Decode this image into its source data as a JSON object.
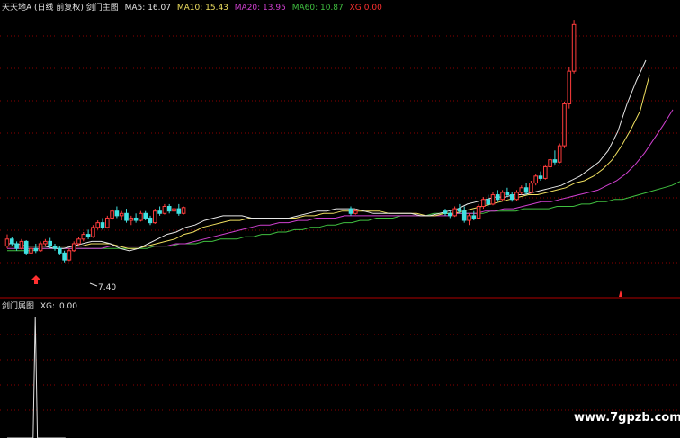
{
  "main_panel": {
    "title": "天天地A (日线 前复权) 剑门主图",
    "legend": [
      {
        "label": "MA5",
        "value": "16.07",
        "color": "#e8e8e8"
      },
      {
        "label": "MA10",
        "value": "15.43",
        "color": "#f0e060"
      },
      {
        "label": "MA20",
        "value": "13.95",
        "color": "#d040d0"
      },
      {
        "label": "MA60",
        "value": "10.87",
        "color": "#40c040"
      },
      {
        "label": "XG",
        "value": "0.00",
        "color": "#ff3030"
      }
    ],
    "low_annotation": "7.40"
  },
  "sub_panel": {
    "title": "剑门属图",
    "legend_label": "XG:",
    "legend_value": "0.00"
  },
  "watermark": "www.7gpzb.com",
  "colors": {
    "up": "#ff3c3c",
    "down": "#40e0e0",
    "grid": "#8b0000",
    "separator": "#b00000",
    "ma5": "#e8e8e8",
    "ma10": "#f0e060",
    "ma20": "#d040d0",
    "ma60": "#40c040",
    "spike": "#e0e0e0"
  },
  "chart_data": [
    {
      "type": "candlestick",
      "title": "剑门主图",
      "ylim": [
        6.0,
        18.5
      ],
      "candles": [
        [
          8.1,
          8.6,
          8.0,
          8.4
        ],
        [
          8.4,
          8.5,
          8.1,
          8.2
        ],
        [
          8.2,
          8.3,
          7.9,
          8.0
        ],
        [
          8.0,
          8.4,
          7.95,
          8.3
        ],
        [
          8.3,
          8.35,
          7.7,
          7.8
        ],
        [
          7.8,
          8.1,
          7.7,
          8.0
        ],
        [
          8.0,
          8.2,
          7.8,
          7.9
        ],
        [
          7.9,
          8.3,
          7.85,
          8.2
        ],
        [
          8.2,
          8.4,
          8.1,
          8.3
        ],
        [
          8.3,
          8.45,
          8.0,
          8.1
        ],
        [
          8.1,
          8.2,
          7.9,
          8.0
        ],
        [
          8.0,
          8.1,
          7.7,
          7.8
        ],
        [
          7.8,
          7.9,
          7.4,
          7.5
        ],
        [
          7.5,
          8.0,
          7.45,
          7.9
        ],
        [
          7.9,
          8.3,
          7.85,
          8.2
        ],
        [
          8.2,
          8.5,
          8.1,
          8.4
        ],
        [
          8.4,
          8.7,
          8.3,
          8.6
        ],
        [
          8.6,
          8.8,
          8.4,
          8.5
        ],
        [
          8.5,
          9.0,
          8.45,
          8.9
        ],
        [
          8.9,
          9.2,
          8.8,
          9.1
        ],
        [
          9.1,
          9.3,
          8.8,
          8.9
        ],
        [
          8.9,
          9.4,
          8.85,
          9.3
        ],
        [
          9.3,
          9.7,
          9.2,
          9.6
        ],
        [
          9.6,
          9.8,
          9.3,
          9.4
        ],
        [
          9.4,
          9.6,
          9.2,
          9.5
        ],
        [
          9.5,
          9.7,
          9.1,
          9.2
        ],
        [
          9.2,
          9.4,
          9.0,
          9.3
        ],
        [
          9.3,
          9.5,
          9.1,
          9.2
        ],
        [
          9.2,
          9.6,
          9.15,
          9.5
        ],
        [
          9.5,
          9.6,
          9.2,
          9.3
        ],
        [
          9.3,
          9.4,
          9.0,
          9.1
        ],
        [
          9.1,
          9.7,
          9.05,
          9.6
        ],
        [
          9.6,
          9.8,
          9.4,
          9.5
        ],
        [
          9.5,
          9.9,
          9.45,
          9.8
        ],
        [
          9.8,
          9.9,
          9.5,
          9.6
        ],
        [
          9.6,
          9.8,
          9.4,
          9.7
        ],
        [
          9.7,
          9.9,
          9.4,
          9.5
        ],
        [
          9.5,
          9.8,
          9.45,
          9.75
        ]
      ],
      "segment2_candles": [
        [
          9.7,
          9.8,
          9.4,
          9.5
        ],
        [
          9.5,
          9.7,
          9.45,
          9.6
        ]
      ],
      "segment3_candles": [
        [
          9.6,
          9.7,
          9.4,
          9.5
        ],
        [
          9.5,
          9.6,
          9.3,
          9.4
        ],
        [
          9.4,
          9.8,
          9.35,
          9.7
        ],
        [
          9.7,
          9.9,
          9.5,
          9.6
        ],
        [
          9.6,
          9.8,
          9.1,
          9.2
        ],
        [
          9.2,
          9.5,
          9.0,
          9.4
        ],
        [
          9.4,
          9.6,
          9.2,
          9.3
        ],
        [
          9.3,
          9.9,
          9.25,
          9.8
        ],
        [
          9.8,
          10.2,
          9.7,
          10.1
        ],
        [
          10.1,
          10.3,
          9.8,
          9.9
        ],
        [
          9.9,
          10.4,
          9.85,
          10.3
        ],
        [
          10.3,
          10.5,
          10.0,
          10.1
        ],
        [
          10.1,
          10.5,
          10.05,
          10.4
        ],
        [
          10.4,
          10.6,
          10.2,
          10.3
        ],
        [
          10.3,
          10.4,
          10.0,
          10.1
        ],
        [
          10.1,
          10.5,
          10.05,
          10.4
        ],
        [
          10.4,
          10.7,
          10.3,
          10.6
        ],
        [
          10.6,
          10.8,
          10.3,
          10.4
        ],
        [
          10.4,
          10.9,
          10.35,
          10.8
        ],
        [
          10.8,
          11.2,
          10.7,
          11.1
        ],
        [
          11.1,
          11.3,
          10.9,
          11.0
        ],
        [
          11.0,
          11.6,
          10.95,
          11.5
        ],
        [
          11.5,
          11.9,
          11.4,
          11.8
        ],
        [
          11.8,
          12.2,
          11.6,
          11.7
        ],
        [
          11.7,
          12.5,
          11.65,
          12.4
        ],
        [
          12.4,
          14.3,
          12.3,
          14.2
        ],
        [
          14.2,
          15.8,
          14.0,
          15.6
        ],
        [
          15.6,
          17.8,
          15.5,
          17.6
        ]
      ],
      "ma5": [
        8.2,
        8.2,
        8.1,
        8.1,
        8.1,
        8.0,
        8.0,
        8.1,
        8.2,
        8.3,
        8.3,
        8.2,
        8.0,
        7.9,
        8.0,
        8.2,
        8.4,
        8.6,
        8.7,
        8.9,
        9.0,
        9.2,
        9.3,
        9.4,
        9.4,
        9.4,
        9.3,
        9.3,
        9.3,
        9.3,
        9.3,
        9.4,
        9.5,
        9.6,
        9.6,
        9.7,
        9.7,
        9.7,
        9.6,
        9.5,
        9.5,
        9.5,
        9.5,
        9.5,
        9.4,
        9.4,
        9.5,
        9.6,
        9.7,
        9.9,
        10.0,
        10.1,
        10.2,
        10.2,
        10.3,
        10.3,
        10.4,
        10.5,
        10.6,
        10.7,
        10.9,
        11.1,
        11.4,
        11.7,
        12.2,
        13.0,
        14.2,
        15.2,
        16.07
      ],
      "ma10": [
        8.1,
        8.1,
        8.1,
        8.1,
        8.1,
        8.1,
        8.1,
        8.1,
        8.1,
        8.2,
        8.2,
        8.2,
        8.1,
        8.0,
        8.0,
        8.1,
        8.2,
        8.3,
        8.4,
        8.6,
        8.7,
        8.9,
        9.0,
        9.1,
        9.2,
        9.2,
        9.3,
        9.3,
        9.3,
        9.3,
        9.3,
        9.3,
        9.4,
        9.4,
        9.5,
        9.5,
        9.6,
        9.6,
        9.6,
        9.6,
        9.6,
        9.5,
        9.5,
        9.5,
        9.5,
        9.4,
        9.4,
        9.5,
        9.5,
        9.6,
        9.7,
        9.8,
        9.9,
        10.0,
        10.1,
        10.2,
        10.3,
        10.3,
        10.4,
        10.5,
        10.6,
        10.8,
        10.9,
        11.1,
        11.4,
        11.8,
        12.4,
        13.1,
        13.9,
        15.43
      ],
      "ma20": [
        8.0,
        8.0,
        8.0,
        8.0,
        8.0,
        8.0,
        8.0,
        8.0,
        8.0,
        8.0,
        8.0,
        8.1,
        8.1,
        8.1,
        8.1,
        8.1,
        8.1,
        8.1,
        8.2,
        8.2,
        8.3,
        8.4,
        8.5,
        8.6,
        8.7,
        8.8,
        8.9,
        9.0,
        9.0,
        9.1,
        9.1,
        9.2,
        9.2,
        9.3,
        9.3,
        9.3,
        9.4,
        9.4,
        9.4,
        9.4,
        9.4,
        9.4,
        9.4,
        9.4,
        9.4,
        9.4,
        9.4,
        9.4,
        9.5,
        9.5,
        9.5,
        9.6,
        9.6,
        9.7,
        9.7,
        9.8,
        9.9,
        10.0,
        10.0,
        10.1,
        10.2,
        10.3,
        10.4,
        10.5,
        10.7,
        10.9,
        11.2,
        11.6,
        12.1,
        12.7,
        13.3,
        13.95
      ],
      "ma60": [
        7.9,
        7.9,
        7.9,
        7.9,
        8.0,
        8.0,
        8.0,
        8.0,
        8.0,
        8.0,
        8.0,
        8.0,
        8.0,
        8.0,
        8.0,
        8.0,
        8.0,
        8.0,
        8.1,
        8.1,
        8.1,
        8.2,
        8.2,
        8.2,
        8.3,
        8.3,
        8.4,
        8.4,
        8.4,
        8.5,
        8.5,
        8.6,
        8.6,
        8.7,
        8.7,
        8.8,
        8.8,
        8.9,
        8.9,
        9.0,
        9.0,
        9.1,
        9.1,
        9.2,
        9.2,
        9.3,
        9.3,
        9.3,
        9.4,
        9.4,
        9.4,
        9.4,
        9.5,
        9.5,
        9.5,
        9.5,
        9.5,
        9.5,
        9.5,
        9.6,
        9.6,
        9.6,
        9.6,
        9.7,
        9.7,
        9.7,
        9.7,
        9.8,
        9.8,
        9.8,
        9.9,
        9.9,
        10.0,
        10.0,
        10.1,
        10.1,
        10.2,
        10.3,
        10.4,
        10.5,
        10.6,
        10.7,
        10.87
      ]
    },
    {
      "type": "bar",
      "title": "剑门属图",
      "series": [
        {
          "name": "XG",
          "values": [
            0,
            0,
            0,
            0,
            0,
            0,
            0,
            0,
            0,
            0,
            0,
            0,
            0,
            1,
            0,
            0,
            0,
            0,
            0,
            0,
            0,
            0,
            0,
            0,
            0,
            0,
            0,
            0
          ]
        }
      ],
      "ylim": [
        0,
        1
      ]
    }
  ]
}
